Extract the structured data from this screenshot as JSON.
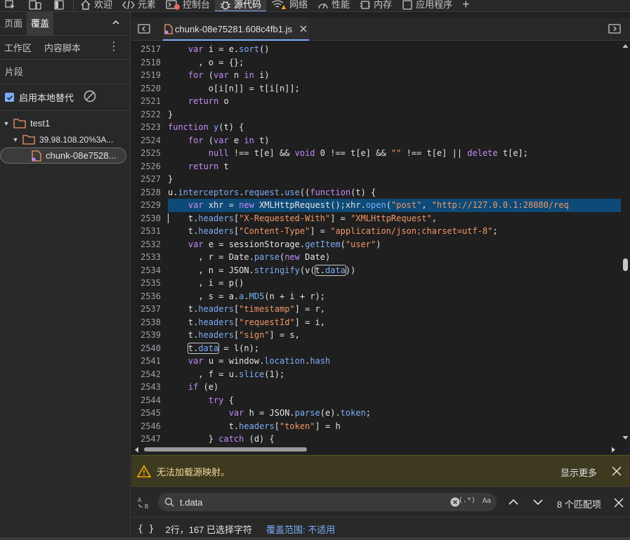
{
  "toolbar": {
    "tabs": [
      {
        "label": "欢迎"
      },
      {
        "label": "元素"
      },
      {
        "label": "控制台"
      },
      {
        "label": "源代码"
      },
      {
        "label": "网络"
      },
      {
        "label": "性能"
      },
      {
        "label": "内存"
      },
      {
        "label": "应用程序"
      }
    ],
    "plus": "+"
  },
  "sidebar": {
    "tabs": [
      {
        "label": "页面"
      },
      {
        "label": "覆盖"
      }
    ],
    "subtabs": [
      {
        "label": "工作区"
      },
      {
        "label": "内容脚本"
      }
    ],
    "more": "⋮",
    "snippets": "片段",
    "enable_override_label": "启用本地替代",
    "tree": [
      {
        "label": "test1"
      },
      {
        "label": "39.98.108.20%3A..."
      },
      {
        "label": "chunk-08e7528..."
      }
    ]
  },
  "editor": {
    "file_tab": "chunk-08e75281.608c4fb1.js",
    "line_numbers": [
      "2517",
      "2518",
      "2519",
      "2520",
      "2521",
      "2522",
      "2523",
      "2524",
      "2525",
      "2526",
      "2527",
      "2528",
      "2529",
      "2530",
      "2531",
      "2532",
      "2533",
      "2534",
      "2535",
      "2536",
      "2537",
      "2538",
      "2539",
      "2540",
      "2541",
      "2542",
      "2543",
      "2544",
      "2545",
      "2546",
      "2547"
    ]
  },
  "warning": {
    "text": "无法加载源映射。",
    "more": "显示更多"
  },
  "search": {
    "value": "t.data",
    "regex": "(.*)",
    "case": "Aa",
    "count": "8 个匹配项"
  },
  "status": {
    "braces": "{ }",
    "selection": "2行，167 已选择字符",
    "coverage": "覆盖范围: 不适用"
  },
  "colors": {
    "accent": "#7cacf8",
    "keyword": "#c58af9",
    "string": "#f29766",
    "warning_bg": "#3d3a20"
  }
}
